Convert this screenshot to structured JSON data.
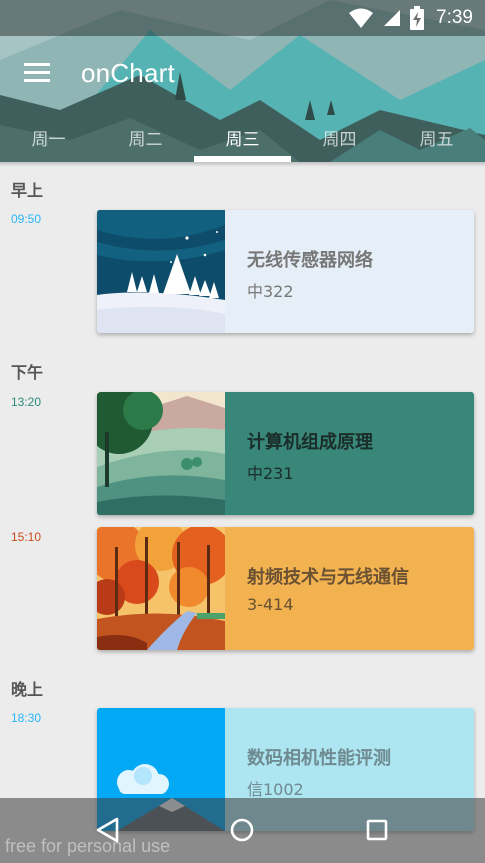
{
  "status_bar": {
    "time": "7:39"
  },
  "app_bar": {
    "title": "onChart"
  },
  "tabs": [
    {
      "label": "周一"
    },
    {
      "label": "周二"
    },
    {
      "label": "周三"
    },
    {
      "label": "周四"
    },
    {
      "label": "周五"
    }
  ],
  "active_tab": "周三",
  "sections": {
    "morning": "早上",
    "afternoon": "下午",
    "evening": "晚上"
  },
  "classes": [
    {
      "time": "09:50",
      "time_color": "#29b6f6",
      "course": "无线传感器网络",
      "room": "中322",
      "card_color": "#e6eff7",
      "text_color": "#777777",
      "image": "snowy-forest-night"
    },
    {
      "time": "13:20",
      "time_color": "#2e8b7a",
      "course": "计算机组成原理",
      "room": "中231",
      "card_color": "#388778",
      "text_color": "#1b2d2a",
      "image": "green-hills-tree"
    },
    {
      "time": "15:10",
      "time_color": "#c94b1c",
      "course": "射频技术与无线通信",
      "room": "3-414",
      "card_color": "#f1b24f",
      "text_color": "#6b5133",
      "image": "autumn-forest-path"
    },
    {
      "time": "18:30",
      "time_color": "#29b6f6",
      "course": "数码相机性能评测",
      "room": "信1002",
      "card_color": "#ade5f0",
      "text_color": "#6f8a90",
      "image": "cloud-mountain-sky"
    }
  ],
  "watermark": "free for personal use",
  "colors": {
    "background": "#ececec",
    "tab_indicator": "#ffffff"
  }
}
